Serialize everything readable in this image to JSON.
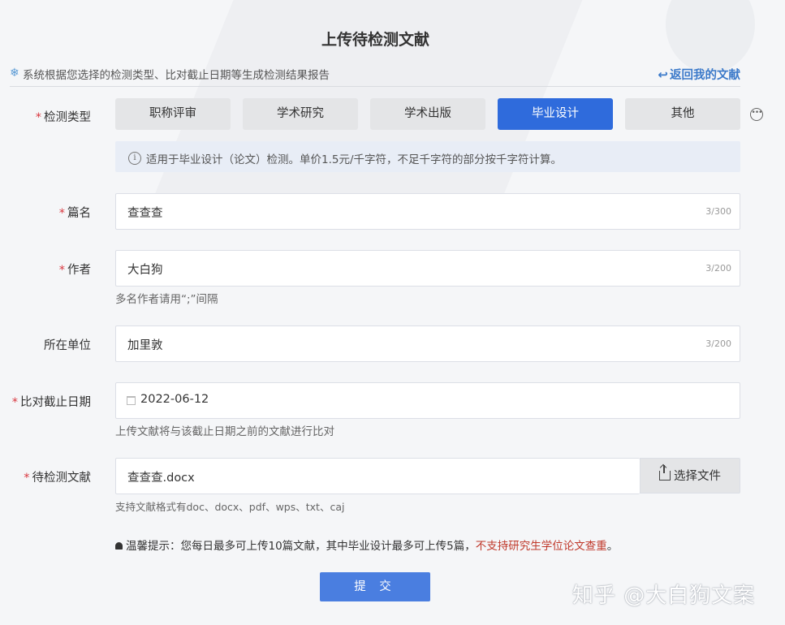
{
  "page": {
    "title": "上传待检测文献",
    "subtitle": "系统根据您选择的检测类型、比对截止日期等生成检测结果报告",
    "back_link": "返回我的文献"
  },
  "detection_type": {
    "label": "检测类型",
    "options": [
      "职称评审",
      "学术研究",
      "学术出版",
      "毕业设计",
      "其他"
    ],
    "selected": "毕业设计",
    "info": "适用于毕业设计（论文）检测。单价1.5元/千字符，不足千字符的部分按千字符计算。"
  },
  "title_field": {
    "label": "篇名",
    "value": "查查查",
    "count": "3/300"
  },
  "author_field": {
    "label": "作者",
    "value": "大白狗",
    "count": "3/200",
    "help": "多名作者请用“;”间隔"
  },
  "org_field": {
    "label": "所在单位",
    "value": "加里敦",
    "count": "3/200"
  },
  "date_field": {
    "label": "比对截止日期",
    "value": "2022-06-12",
    "help": "上传文献将与该截止日期之前的文献进行比对"
  },
  "file_field": {
    "label": "待检测文献",
    "value": "查查查.docx",
    "button": "选择文件",
    "help": "支持文献格式有doc、docx、pdf、wps、txt、caj"
  },
  "tip": {
    "prefix": "温馨提示：您每日最多可上传10篇文献，其中毕业设计最多可上传5篇，",
    "warning": "不支持研究生学位论文查重",
    "suffix": "。"
  },
  "submit": "提 交",
  "watermark": "知乎 @大白狗文案",
  "colors": {
    "primary": "#2f6bdc",
    "required": "#d9363e",
    "warning": "#c0392b",
    "link": "#3b79c9"
  },
  "icons": {
    "snowflake": "❄",
    "back_arrow": "↩",
    "more": "•••",
    "info": "i"
  }
}
